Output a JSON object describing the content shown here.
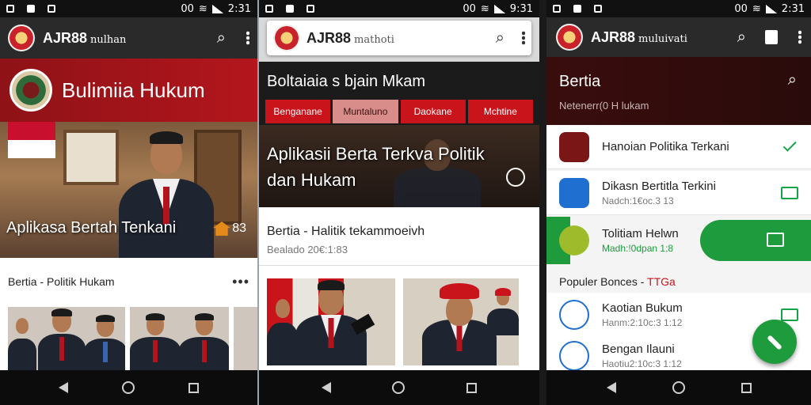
{
  "status": {
    "left_time": "2:31",
    "mid_time": "9:31",
    "right_time": "2:31",
    "left_batt": "00",
    "mid_batt": "00",
    "right_batt": "00"
  },
  "screen1": {
    "app_name": "AJR88",
    "app_sub": "nulhan",
    "banner_title": "Bulimiia Hukum",
    "hero_caption": "Aplikasa Bertah Tenkani",
    "hero_count": "83",
    "section_title": "Bertia - Politik Hukam",
    "section_more": "•••"
  },
  "screen2": {
    "app_name": "AJR88",
    "app_sub": "mathoti",
    "header_title": "Boltaiaia s bjain Mkam",
    "tabs": [
      {
        "label": "Benganane"
      },
      {
        "label": "Muntaluno"
      },
      {
        "label": "Daokane"
      },
      {
        "label": "Mchtine"
      }
    ],
    "hero_caption_line1": "Aplikasii Berta Terkva Politik",
    "hero_caption_line2": "dan Hukam",
    "card_title": "Bertia - Halitik tekammoeivh",
    "card_sub": "Bealado 20€:1:83"
  },
  "screen3": {
    "app_name": "AJR88",
    "app_sub": "muluivati",
    "header_title": "Bertia",
    "header_sub": "Netenerr(0 H lukam",
    "items": [
      {
        "title": "Hanoian Politika Terkani",
        "sub": ""
      },
      {
        "title": "Dikasn Bertitla Terkini",
        "sub": "Nadch:1€oc.3 13"
      },
      {
        "title": "Tolitiam Helwn",
        "sub": "Madh:!0dpan 1:8"
      },
      {
        "title": "Kaotian Bukum",
        "sub": "Hanm:2:10c:3 1:12"
      },
      {
        "title": "Bengan Ilauni",
        "sub": "Haotiu2:10c:3 1:12"
      }
    ],
    "section_title": "Populer Bonces - ",
    "section_title_accent": "TTGa"
  },
  "colors": {
    "brand_red": "#b3161c",
    "tab_red": "#c9141c",
    "green": "#1e9b3c",
    "dark": "#2a2a2a"
  }
}
